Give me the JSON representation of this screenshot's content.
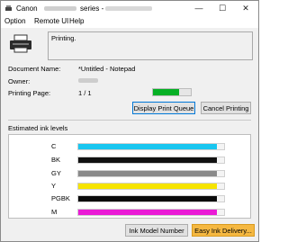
{
  "window": {
    "title_prefix": "Canon",
    "title_suffix": "series -",
    "min_glyph": "—",
    "max_glyph": "☐",
    "close_glyph": "✕"
  },
  "menu": {
    "items": [
      "Option",
      "Remote UI",
      "Help"
    ]
  },
  "status": {
    "text": "Printing."
  },
  "info": {
    "document_label": "Document Name:",
    "document_value": "*Untitled - Notepad",
    "owner_label": "Owner:",
    "printing_page_label": "Printing Page:",
    "printing_page_value": "1 / 1",
    "progress_fraction": 0.7,
    "progress_color": "#06b025"
  },
  "buttons": {
    "display_queue": "Display Print Queue",
    "cancel_printing": "Cancel Printing",
    "ink_model": "Ink Model Number",
    "easy_ink": "Easy Ink Delivery..."
  },
  "ink": {
    "heading": "Estimated ink levels",
    "items": [
      {
        "name": "C",
        "color": "#19c6f0",
        "level": 0.95
      },
      {
        "name": "BK",
        "color": "#111111",
        "level": 0.95
      },
      {
        "name": "GY",
        "color": "#8a8a8a",
        "level": 0.95
      },
      {
        "name": "Y",
        "color": "#f6e400",
        "level": 0.95
      },
      {
        "name": "PGBK",
        "color": "#0a0a0a",
        "level": 0.95
      },
      {
        "name": "M",
        "color": "#ea1bd6",
        "level": 0.95
      }
    ]
  }
}
